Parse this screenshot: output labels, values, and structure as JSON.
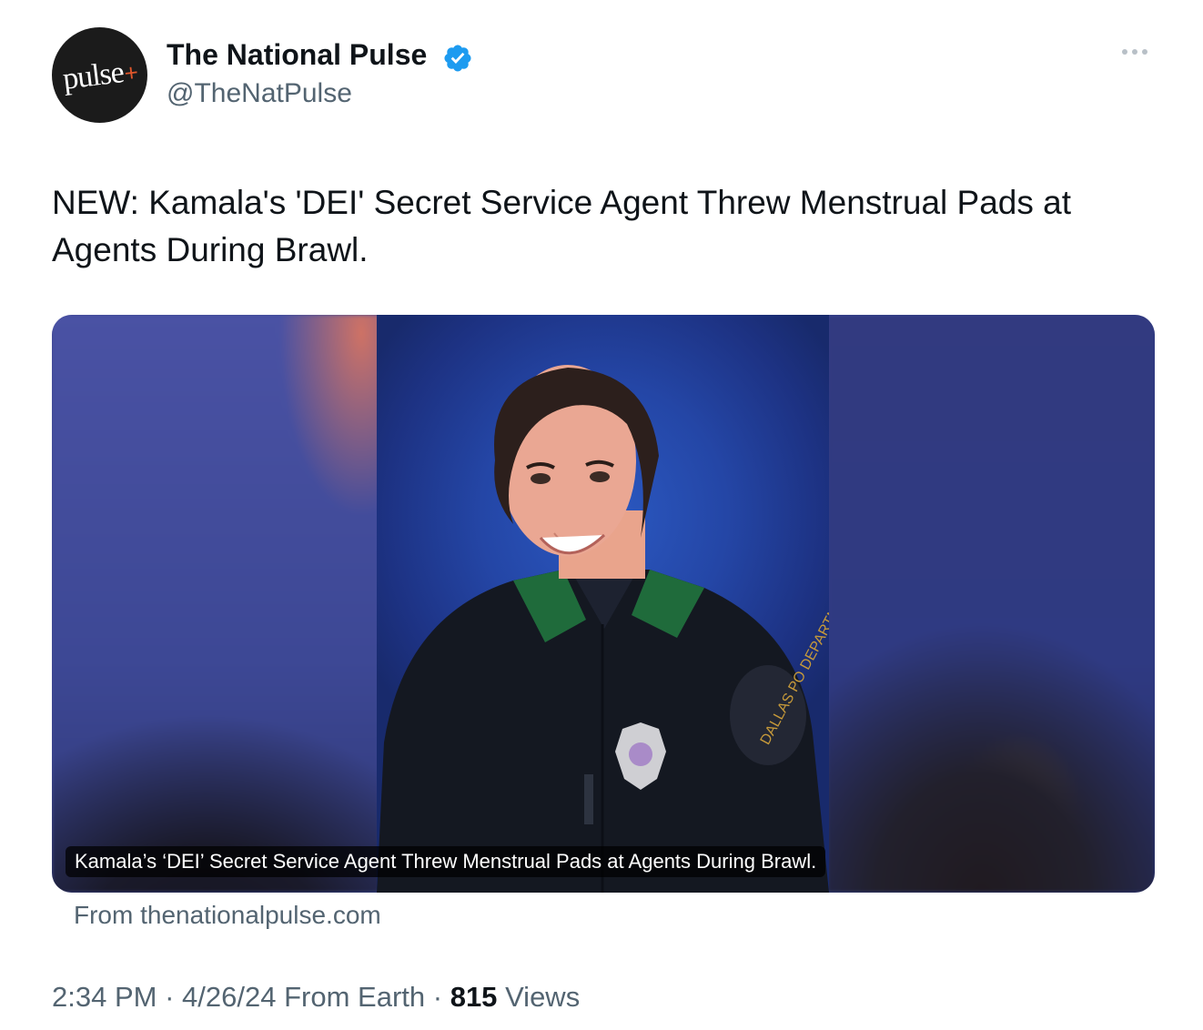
{
  "author": {
    "avatar_text": "pulse",
    "avatar_plus": "+",
    "display_name": "The National Pulse",
    "handle": "@TheNatPulse",
    "verified": true,
    "verified_color": "#1d9bf0"
  },
  "tweet": {
    "text": "NEW: Kamala's 'DEI' Secret Service Agent Threw Menstrual Pads at Agents During Brawl."
  },
  "media": {
    "caption": "Kamala’s ‘DEI’ Secret Service Agent Threw Menstrual Pads at Agents During Brawl.",
    "source": "From thenationalpulse.com",
    "patch_text": "DALLAS PO DEPARTM"
  },
  "meta": {
    "time": "2:34 PM",
    "date": "4/26/24",
    "source": "From Earth",
    "views_count": "815",
    "views_label": "Views",
    "separator": "·"
  },
  "colors": {
    "text_primary": "#0f1419",
    "text_secondary": "#536471",
    "accent": "#1d9bf0",
    "avatar_accent": "#e2572b"
  },
  "icons": {
    "verified": "verified-badge-icon",
    "more": "more-dots-icon"
  }
}
